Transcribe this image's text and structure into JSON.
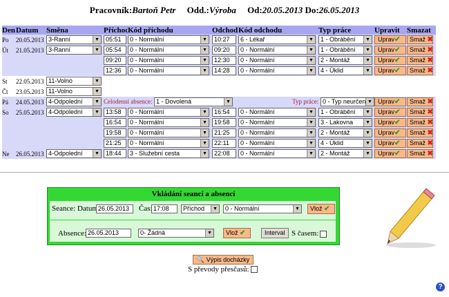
{
  "header": {
    "worker_label": "Pracovník:",
    "worker_name": "Bartoň Petr",
    "dept_label": "Odd.:",
    "dept_name": "Výroba",
    "from_label": "Od:",
    "from_date": "20.05.2013",
    "to_label": "Do:",
    "to_date": "26.05.2013"
  },
  "columns": [
    "Den",
    "Datum",
    "Směna",
    "Příchod",
    "Kód příchodu",
    "Odchod",
    "Kód odchodu",
    "Typ práce",
    "Upravit",
    "Smazat"
  ],
  "buttons": {
    "edit": "Uprav",
    "delete": "Smaž"
  },
  "rows": [
    {
      "bg": "r1",
      "day": "Po",
      "date": "20.05.2013",
      "shift": "3-Ranní",
      "arr": "05:51",
      "arr_code": "0 - Normální",
      "dep": "10:27",
      "dep_code": "6 - Lékař",
      "work": "1 - Obrábění"
    },
    {
      "bg": "r1",
      "day": "Út",
      "date": "21.05.2013",
      "shift": "3-Ranní",
      "arr": "05:54",
      "arr_code": "0 - Normální",
      "dep": "09:20",
      "dep_code": "0 - Normální",
      "work": "1 - Obrábění"
    },
    {
      "bg": "r1",
      "day": "",
      "date": "",
      "shift": "",
      "arr": "09:20",
      "arr_code": "0 - Normální",
      "dep": "12:30",
      "dep_code": "0 - Normální",
      "work": "2 - Montáž"
    },
    {
      "bg": "r1",
      "day": "",
      "date": "",
      "shift": "",
      "arr": "12:36",
      "arr_code": "0 - Normální",
      "dep": "14:28",
      "dep_code": "0 - Normální",
      "work": "4 - Úklid"
    },
    {
      "bg": "r2",
      "day": "St",
      "date": "22.05.2013",
      "shift": "11-Volno"
    },
    {
      "bg": "r2",
      "day": "Čt",
      "date": "23.05.2013",
      "shift": "11-Volno"
    },
    {
      "bg": "r1",
      "day": "Pá",
      "date": "24.05.2013",
      "shift": "4-Odpolední",
      "absence_label": "Celodenní absence:",
      "absence": "1 - Dovolená",
      "worktype_label": "Typ práce:",
      "worktype": "0 - Typ neurčen"
    },
    {
      "bg": "r1",
      "day": "So",
      "date": "25.05.2013",
      "shift": "4-Odpolední",
      "arr": "13:58",
      "arr_code": "0 - Normální",
      "dep": "16:54",
      "dep_code": "0 - Normální",
      "work": "1 - Obrábění"
    },
    {
      "bg": "r1",
      "day": "",
      "date": "",
      "shift": "",
      "arr": "16:54",
      "arr_code": "0 - Normální",
      "dep": "19:58",
      "dep_code": "0 - Normální",
      "work": "3 - Lakovna"
    },
    {
      "bg": "r1",
      "day": "",
      "date": "",
      "shift": "",
      "arr": "19:58",
      "arr_code": "0 - Normální",
      "dep": "21:25",
      "dep_code": "0 - Normální",
      "work": "2 - Montáž"
    },
    {
      "bg": "r1",
      "day": "",
      "date": "",
      "shift": "",
      "arr": "21:25",
      "arr_code": "0 - Normální",
      "dep": "22:11",
      "dep_code": "0 - Normální",
      "work": "4 - Úklid"
    },
    {
      "bg": "r1",
      "day": "Ne",
      "date": "26.05.2013",
      "shift": "4-Odpolední",
      "arr": "18:44",
      "arr_code": "3 - Služební cesta",
      "dep": "22:08",
      "dep_code": "0 - Normální",
      "work": "2 - Montáž"
    }
  ],
  "form": {
    "title": "Vkládání seancí a absencí",
    "seance_label": "Seance: Datum:",
    "seance_date": "26.05.2013",
    "time_label": "Čas:",
    "time": "17:08",
    "direction": "Příchod",
    "code": "0 - Normální",
    "insert": "Vlož",
    "absence_label": "Absence:",
    "absence_date": "26.05.2013",
    "absence_type": "0- Žádná",
    "interval": "Interval",
    "with_time": "S časem:"
  },
  "footer": {
    "report_button": "Výpis docházky",
    "transfers_label": "S převody přesčasů:",
    "help": "?"
  },
  "colors": {
    "header_bg": "#a7a7f1",
    "row_bg": "#d8d8f9",
    "form_bg": "#33d833",
    "button_bg": "#f8b888"
  }
}
